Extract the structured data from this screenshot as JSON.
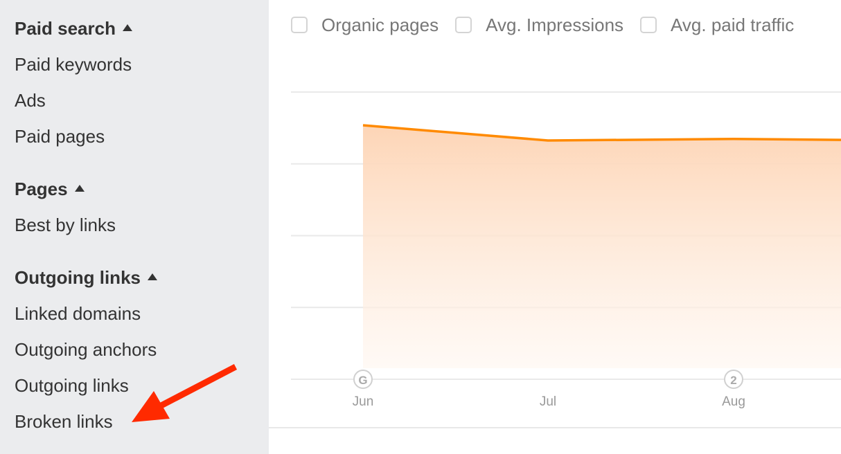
{
  "sidebar": {
    "sections": [
      {
        "title": "Paid search",
        "items": [
          "Paid keywords",
          "Ads",
          "Paid pages"
        ]
      },
      {
        "title": "Pages",
        "items": [
          "Best by links"
        ]
      },
      {
        "title": "Outgoing links",
        "items": [
          "Linked domains",
          "Outgoing anchors",
          "Outgoing links",
          "Broken links"
        ]
      }
    ]
  },
  "legend": [
    {
      "label": "Organic pages",
      "checked": false
    },
    {
      "label": "Avg. Impressions",
      "checked": false
    },
    {
      "label": "Avg. paid traffic",
      "checked": false
    }
  ],
  "colors": {
    "series": "#ff8a00",
    "fill": "#fdd9bd",
    "annotation_arrow": "#ff2a00"
  },
  "chart_data": {
    "type": "area",
    "title": "",
    "xlabel": "",
    "ylabel": "",
    "categories": [
      "Jun",
      "Jul",
      "Aug",
      ""
    ],
    "series": [
      {
        "name": "traffic",
        "values": [
          0.91,
          0.86,
          0.865,
          0.862
        ]
      }
    ],
    "ylim": [
      0,
      1
    ],
    "grid": true,
    "y_gridlines": 5,
    "annotations": [
      {
        "x": "Jun",
        "label": "G"
      },
      {
        "x": "Aug",
        "label": "2"
      }
    ],
    "tick_labels": [
      "Jun",
      "Jul",
      "Aug"
    ]
  }
}
